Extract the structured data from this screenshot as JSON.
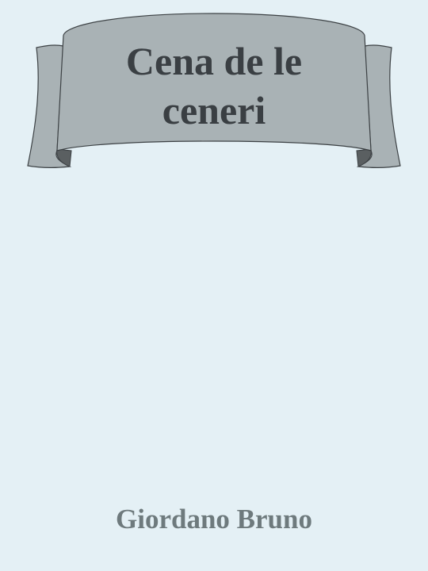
{
  "cover": {
    "title_line_1": "Cena de le",
    "title_line_2": "ceneri",
    "author": "Giordano Bruno"
  },
  "colors": {
    "background": "#e4f0f5",
    "banner_fill": "#a9b2b5",
    "banner_shadow": "#5a5f61",
    "banner_outline": "#3c4144",
    "title_text": "#3a3f43",
    "author_text": "#6e7a7d"
  }
}
